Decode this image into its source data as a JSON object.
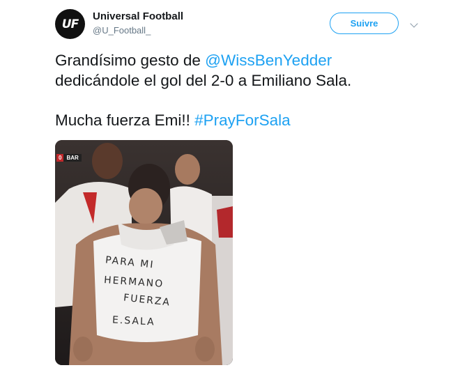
{
  "tweet": {
    "author": {
      "avatar_text": "UF",
      "display_name": "Universal Football",
      "handle": "@U_Football_"
    },
    "follow_button_label": "Suivre",
    "text": {
      "line1_prefix": "Grandísimo gesto de ",
      "mention": "@WissBenYedder",
      "line2": "dedicándole el gol del 2-0 a Emiliano Sala.",
      "line3_prefix": "Mucha fuerza Emi!! ",
      "hashtag": "#PrayForSala"
    },
    "media": {
      "score_badge": {
        "score": "0",
        "team": "BAR"
      },
      "shirt_lines": [
        "PARA MI",
        "HERMANO",
        "FUERZA",
        "E.SALA"
      ]
    }
  },
  "colors": {
    "accent": "#1da1f2",
    "text": "#14171a",
    "secondary_text": "#657786"
  },
  "icons": [
    "chevron-down-icon"
  ]
}
